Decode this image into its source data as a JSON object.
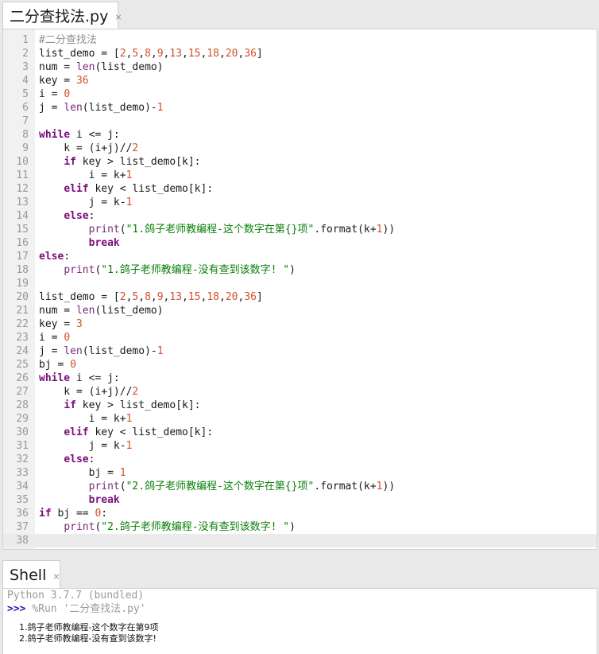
{
  "editor_tab": {
    "title": "二分查找法.py",
    "close": "×"
  },
  "editor": {
    "current_line": 38,
    "lines": [
      [
        {
          "t": "#二分查找法",
          "c": "com"
        }
      ],
      [
        {
          "t": "list_demo = ["
        },
        {
          "t": "2",
          "c": "num"
        },
        {
          "t": ","
        },
        {
          "t": "5",
          "c": "num"
        },
        {
          "t": ","
        },
        {
          "t": "8",
          "c": "num"
        },
        {
          "t": ","
        },
        {
          "t": "9",
          "c": "num"
        },
        {
          "t": ","
        },
        {
          "t": "13",
          "c": "num"
        },
        {
          "t": ","
        },
        {
          "t": "15",
          "c": "num"
        },
        {
          "t": ","
        },
        {
          "t": "18",
          "c": "num"
        },
        {
          "t": ","
        },
        {
          "t": "20",
          "c": "num"
        },
        {
          "t": ","
        },
        {
          "t": "36",
          "c": "num"
        },
        {
          "t": "]"
        }
      ],
      [
        {
          "t": "num = "
        },
        {
          "t": "len",
          "c": "bi"
        },
        {
          "t": "(list_demo)"
        }
      ],
      [
        {
          "t": "key = "
        },
        {
          "t": "36",
          "c": "num"
        }
      ],
      [
        {
          "t": "i = "
        },
        {
          "t": "0",
          "c": "num"
        }
      ],
      [
        {
          "t": "j = "
        },
        {
          "t": "len",
          "c": "bi"
        },
        {
          "t": "(list_demo)-"
        },
        {
          "t": "1",
          "c": "num"
        }
      ],
      [],
      [
        {
          "t": "while",
          "c": "kw"
        },
        {
          "t": " i <= j:"
        }
      ],
      [
        {
          "t": "    k = (i+j)//"
        },
        {
          "t": "2",
          "c": "num"
        }
      ],
      [
        {
          "t": "    "
        },
        {
          "t": "if",
          "c": "kw"
        },
        {
          "t": " key > list_demo[k]:"
        }
      ],
      [
        {
          "t": "        i = k+"
        },
        {
          "t": "1",
          "c": "num"
        }
      ],
      [
        {
          "t": "    "
        },
        {
          "t": "elif",
          "c": "kw"
        },
        {
          "t": " key < list_demo[k]:"
        }
      ],
      [
        {
          "t": "        j = k-"
        },
        {
          "t": "1",
          "c": "num"
        }
      ],
      [
        {
          "t": "    "
        },
        {
          "t": "else",
          "c": "kw"
        },
        {
          "t": ":"
        }
      ],
      [
        {
          "t": "        "
        },
        {
          "t": "print",
          "c": "bi"
        },
        {
          "t": "("
        },
        {
          "t": "\"1.鸽子老师教编程-这个数字在第{}项\"",
          "c": "str"
        },
        {
          "t": ".format(k+"
        },
        {
          "t": "1",
          "c": "num"
        },
        {
          "t": "))"
        }
      ],
      [
        {
          "t": "        "
        },
        {
          "t": "break",
          "c": "kw"
        }
      ],
      [
        {
          "t": "else",
          "c": "kw"
        },
        {
          "t": ":"
        }
      ],
      [
        {
          "t": "    "
        },
        {
          "t": "print",
          "c": "bi"
        },
        {
          "t": "("
        },
        {
          "t": "\"1.鸽子老师教编程-没有查到该数字! \"",
          "c": "str"
        },
        {
          "t": ")"
        }
      ],
      [],
      [
        {
          "t": "list_demo = ["
        },
        {
          "t": "2",
          "c": "num"
        },
        {
          "t": ","
        },
        {
          "t": "5",
          "c": "num"
        },
        {
          "t": ","
        },
        {
          "t": "8",
          "c": "num"
        },
        {
          "t": ","
        },
        {
          "t": "9",
          "c": "num"
        },
        {
          "t": ","
        },
        {
          "t": "13",
          "c": "num"
        },
        {
          "t": ","
        },
        {
          "t": "15",
          "c": "num"
        },
        {
          "t": ","
        },
        {
          "t": "18",
          "c": "num"
        },
        {
          "t": ","
        },
        {
          "t": "20",
          "c": "num"
        },
        {
          "t": ","
        },
        {
          "t": "36",
          "c": "num"
        },
        {
          "t": "]"
        }
      ],
      [
        {
          "t": "num = "
        },
        {
          "t": "len",
          "c": "bi"
        },
        {
          "t": "(list_demo)"
        }
      ],
      [
        {
          "t": "key = "
        },
        {
          "t": "3",
          "c": "num"
        }
      ],
      [
        {
          "t": "i = "
        },
        {
          "t": "0",
          "c": "num"
        }
      ],
      [
        {
          "t": "j = "
        },
        {
          "t": "len",
          "c": "bi"
        },
        {
          "t": "(list_demo)-"
        },
        {
          "t": "1",
          "c": "num"
        }
      ],
      [
        {
          "t": "bj = "
        },
        {
          "t": "0",
          "c": "num"
        }
      ],
      [
        {
          "t": "while",
          "c": "kw"
        },
        {
          "t": " i <= j:"
        }
      ],
      [
        {
          "t": "    k = (i+j)//"
        },
        {
          "t": "2",
          "c": "num"
        }
      ],
      [
        {
          "t": "    "
        },
        {
          "t": "if",
          "c": "kw"
        },
        {
          "t": " key > list_demo[k]:"
        }
      ],
      [
        {
          "t": "        i = k+"
        },
        {
          "t": "1",
          "c": "num"
        }
      ],
      [
        {
          "t": "    "
        },
        {
          "t": "elif",
          "c": "kw"
        },
        {
          "t": " key < list_demo[k]:"
        }
      ],
      [
        {
          "t": "        j = k-"
        },
        {
          "t": "1",
          "c": "num"
        }
      ],
      [
        {
          "t": "    "
        },
        {
          "t": "else",
          "c": "kw"
        },
        {
          "t": ":"
        }
      ],
      [
        {
          "t": "        bj = "
        },
        {
          "t": "1",
          "c": "num"
        }
      ],
      [
        {
          "t": "        "
        },
        {
          "t": "print",
          "c": "bi"
        },
        {
          "t": "("
        },
        {
          "t": "\"2.鸽子老师教编程-这个数字在第{}项\"",
          "c": "str"
        },
        {
          "t": ".format(k+"
        },
        {
          "t": "1",
          "c": "num"
        },
        {
          "t": "))"
        }
      ],
      [
        {
          "t": "        "
        },
        {
          "t": "break",
          "c": "kw"
        }
      ],
      [
        {
          "t": "if",
          "c": "kw"
        },
        {
          "t": " bj == "
        },
        {
          "t": "0",
          "c": "num"
        },
        {
          "t": ":"
        }
      ],
      [
        {
          "t": "    "
        },
        {
          "t": "print",
          "c": "bi"
        },
        {
          "t": "("
        },
        {
          "t": "\"2.鸽子老师教编程-没有查到该数字! \"",
          "c": "str"
        },
        {
          "t": ")"
        }
      ],
      []
    ]
  },
  "shell_tab": {
    "title": "Shell",
    "close": "×"
  },
  "shell": {
    "banner": "Python 3.7.7 (bundled)",
    "prompt": ">>>",
    "command": "%Run '二分查找法.py'",
    "output": [
      "1.鸽子老师教编程-这个数字在第9项",
      "2.鸽子老师教编程-没有查到该数字!"
    ]
  }
}
